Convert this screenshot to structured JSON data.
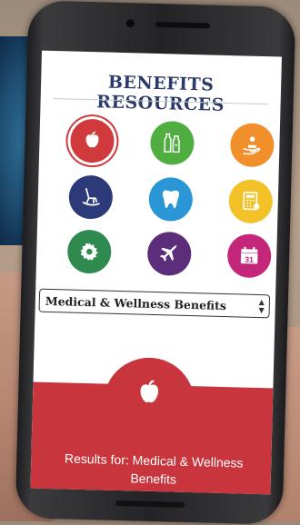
{
  "app": {
    "title": "BENEFITS RESOURCES"
  },
  "categories": [
    {
      "icon": "apple-icon",
      "color": "#d03a3d",
      "selected": true
    },
    {
      "icon": "bottles-icon",
      "color": "#4fae3f",
      "selected": false
    },
    {
      "icon": "hand-care-icon",
      "color": "#f18f2a",
      "selected": false
    },
    {
      "icon": "rocking-chair-icon",
      "color": "#2d3a7a",
      "selected": false
    },
    {
      "icon": "tooth-icon",
      "color": "#2a96d5",
      "selected": false
    },
    {
      "icon": "calculator-icon",
      "color": "#f2c228",
      "selected": false
    },
    {
      "icon": "gear-icon",
      "color": "#2f8a50",
      "selected": false
    },
    {
      "icon": "airplane-icon",
      "color": "#5c2d7a",
      "selected": false
    },
    {
      "icon": "calendar-icon",
      "color": "#c4277a",
      "selected": false
    }
  ],
  "calendar_day": "31",
  "dropdown": {
    "selected": "Medical & Wellness Benefits"
  },
  "results": {
    "label": "Results for: Medical & Wellness Benefits",
    "icon": "apple-icon",
    "color": "#c9353d"
  }
}
